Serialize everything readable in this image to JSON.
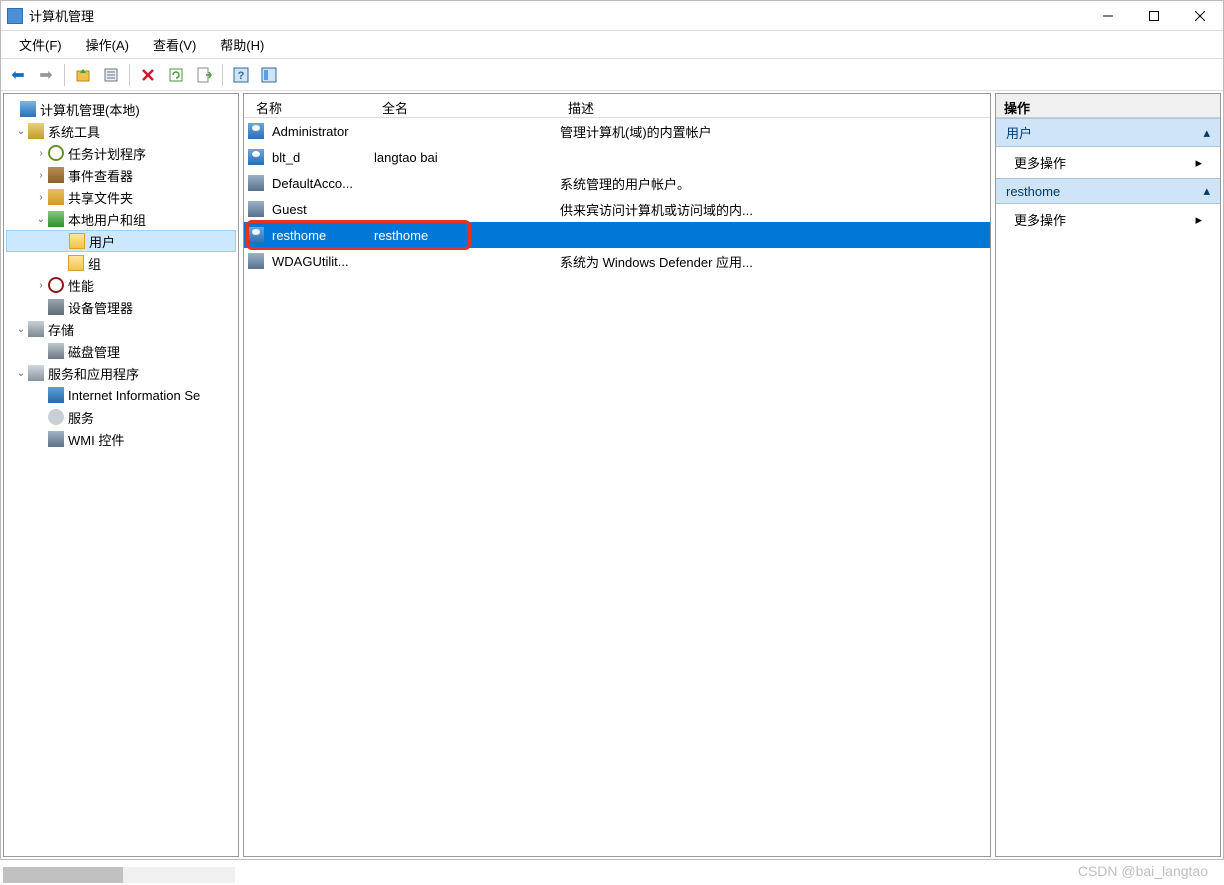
{
  "window": {
    "title": "计算机管理"
  },
  "menu": {
    "file": "文件(F)",
    "action": "操作(A)",
    "view": "查看(V)",
    "help": "帮助(H)"
  },
  "tree": {
    "root": "计算机管理(本地)",
    "sys_tools": "系统工具",
    "task_sched": "任务计划程序",
    "event_viewer": "事件查看器",
    "shared": "共享文件夹",
    "local_users": "本地用户和组",
    "users": "用户",
    "groups": "组",
    "perf": "性能",
    "device_mgr": "设备管理器",
    "storage": "存储",
    "disk_mgmt": "磁盘管理",
    "services_apps": "服务和应用程序",
    "iis": "Internet Information Se",
    "services": "服务",
    "wmi": "WMI 控件"
  },
  "list": {
    "headers": {
      "name": "名称",
      "fullname": "全名",
      "desc": "描述"
    },
    "rows": [
      {
        "name": "Administrator",
        "fullname": "",
        "desc": "管理计算机(域)的内置帐户"
      },
      {
        "name": "blt_d",
        "fullname": "langtao bai",
        "desc": ""
      },
      {
        "name": "DefaultAcco...",
        "fullname": "",
        "desc": "系统管理的用户帐户。"
      },
      {
        "name": "Guest",
        "fullname": "",
        "desc": "供来宾访问计算机或访问域的内..."
      },
      {
        "name": "resthome",
        "fullname": "resthome",
        "desc": ""
      },
      {
        "name": "WDAGUtilit...",
        "fullname": "",
        "desc": "系统为 Windows Defender 应用..."
      }
    ]
  },
  "actions": {
    "header": "操作",
    "users": "用户",
    "more1": "更多操作",
    "resthome": "resthome",
    "more2": "更多操作"
  },
  "watermark": "CSDN @bai_langtao"
}
